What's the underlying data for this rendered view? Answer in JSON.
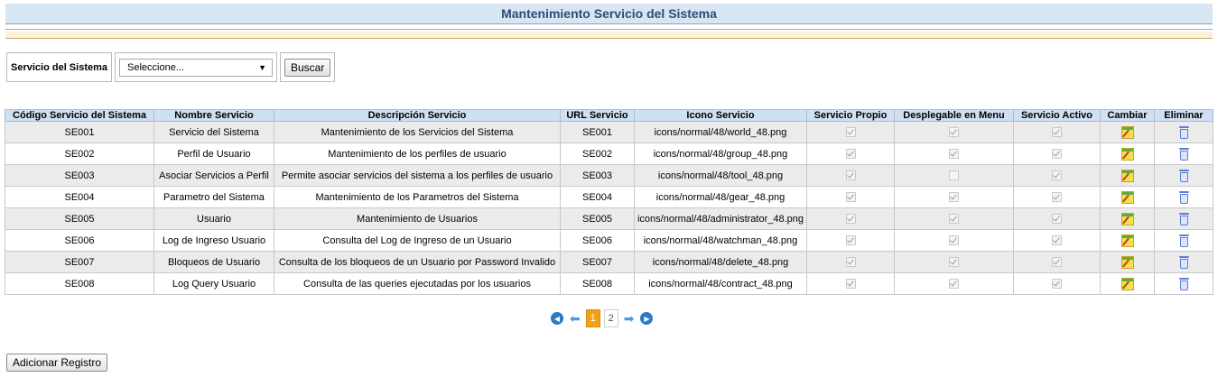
{
  "page": {
    "title": "Mantenimiento Servicio del Sistema"
  },
  "filter": {
    "label": "Servicio del Sistema",
    "select_value": "Seleccione...",
    "search_button": "Buscar"
  },
  "table": {
    "headers": [
      "Código Servicio del Sistema",
      "Nombre Servicio",
      "Descripción Servicio",
      "URL Servicio",
      "Icono Servicio",
      "Servicio Propio",
      "Desplegable en Menu",
      "Servicio Activo",
      "Cambiar",
      "Eliminar"
    ],
    "rows": [
      {
        "code": "SE001",
        "name": "Servicio del Sistema",
        "description": "Mantenimiento de los Servicios del Sistema",
        "url": "SE001",
        "icon": "icons/normal/48/world_48.png",
        "propio": true,
        "menu": true,
        "activo": true
      },
      {
        "code": "SE002",
        "name": "Perfil de Usuario",
        "description": "Mantenimiento de los perfiles de usuario",
        "url": "SE002",
        "icon": "icons/normal/48/group_48.png",
        "propio": true,
        "menu": true,
        "activo": true
      },
      {
        "code": "SE003",
        "name": "Asociar Servicios a Perfil",
        "description": "Permite asociar servicios del sistema a los perfiles de usuario",
        "url": "SE003",
        "icon": "icons/normal/48/tool_48.png",
        "propio": true,
        "menu": false,
        "activo": true
      },
      {
        "code": "SE004",
        "name": "Parametro del Sistema",
        "description": "Mantenimiento de los Parametros del Sistema",
        "url": "SE004",
        "icon": "icons/normal/48/gear_48.png",
        "propio": true,
        "menu": true,
        "activo": true
      },
      {
        "code": "SE005",
        "name": "Usuario",
        "description": "Mantenimiento de Usuarios",
        "url": "SE005",
        "icon": "icons/normal/48/administrator_48.png",
        "propio": true,
        "menu": true,
        "activo": true
      },
      {
        "code": "SE006",
        "name": "Log de Ingreso Usuario",
        "description": "Consulta del Log de Ingreso de un Usuario",
        "url": "SE006",
        "icon": "icons/normal/48/watchman_48.png",
        "propio": true,
        "menu": true,
        "activo": true
      },
      {
        "code": "SE007",
        "name": "Bloqueos de Usuario",
        "description": "Consulta de los bloqueos de un Usuario por Password Invalido",
        "url": "SE007",
        "icon": "icons/normal/48/delete_48.png",
        "propio": true,
        "menu": true,
        "activo": true
      },
      {
        "code": "SE008",
        "name": "Log Query Usuario",
        "description": "Consulta de las queries ejecutadas por los usuarios",
        "url": "SE008",
        "icon": "icons/normal/48/contract_48.png",
        "propio": true,
        "menu": true,
        "activo": true
      }
    ],
    "edit_icon": "edit-icon",
    "delete_icon": "trash-icon"
  },
  "pager": {
    "pages": [
      "1",
      "2"
    ],
    "current": "1",
    "first_icon": "first-page-icon",
    "prev_icon": "prev-page-icon",
    "next_icon": "next-page-icon",
    "last_icon": "last-page-icon"
  },
  "actions": {
    "add_button": "Adicionar Registro"
  },
  "colors": {
    "title_bg": "#d8e6f4",
    "title_text": "#2b4d78",
    "header_bg": "#cfe0f2",
    "row_alt": "#ebebeb",
    "pager_active": "#f3a218",
    "pager_icon": "#2b7bc4"
  }
}
